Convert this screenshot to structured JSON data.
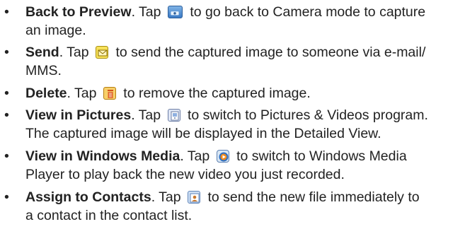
{
  "items": [
    {
      "term": "Back to Preview",
      "before": ". Tap ",
      "icon": "camera-preview-icon",
      "after": " to go back to Camera mode to capture",
      "cont": "an image."
    },
    {
      "term": "Send",
      "before": ". Tap ",
      "icon": "envelope-send-icon",
      "after": " to send the captured image to someone via e-mail/",
      "cont": "MMS."
    },
    {
      "term": "Delete",
      "before": ". Tap ",
      "icon": "trash-delete-icon",
      "after": " to remove the captured image.",
      "cont": ""
    },
    {
      "term": "View in Pictures",
      "before": ". Tap ",
      "icon": "pictures-icon",
      "after": " to switch to Pictures & Videos program.",
      "cont": "The captured image will be displayed in the Detailed View."
    },
    {
      "term": "View in Windows Media",
      "before": ". Tap ",
      "icon": "windows-media-icon",
      "after": " to switch to Windows Media",
      "cont": "Player to play back the new video you just recorded."
    },
    {
      "term": "Assign to Contacts",
      "before": ". Tap ",
      "icon": "assign-contact-icon",
      "after": " to send the new file immediately to",
      "cont": "a contact in the contact list."
    }
  ],
  "bullet": "•"
}
